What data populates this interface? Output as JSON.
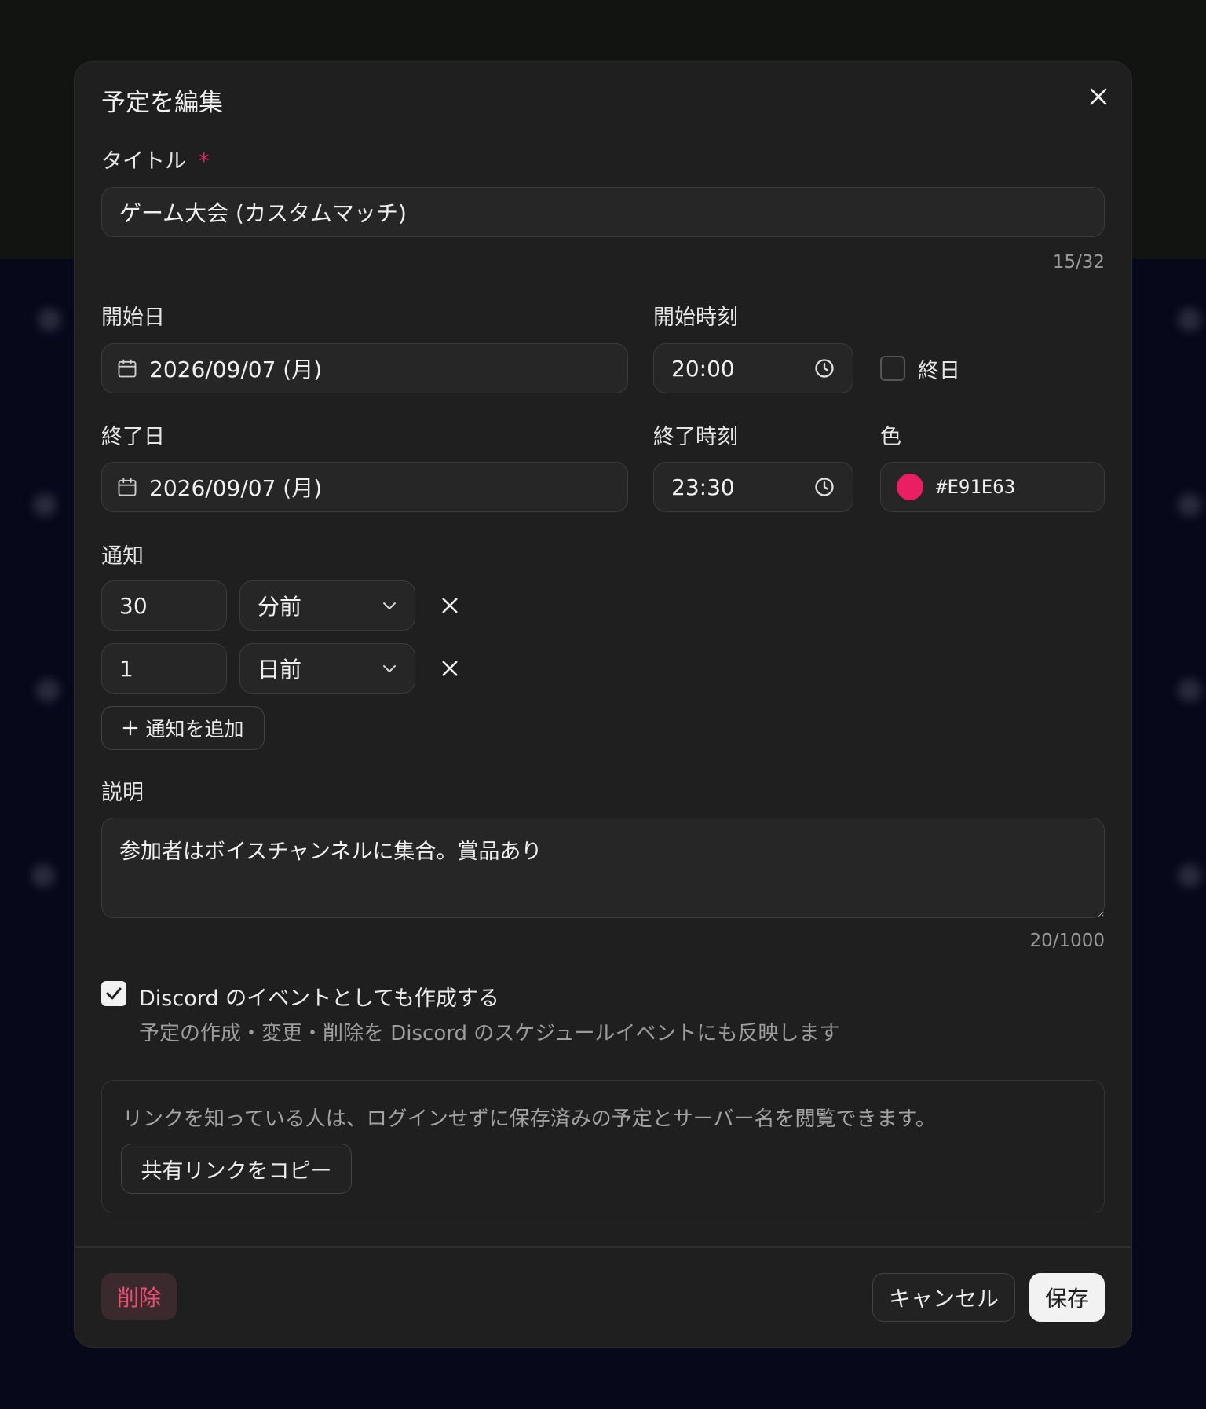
{
  "modal": {
    "title": "予定を編集"
  },
  "title_field": {
    "label": "タイトル",
    "required_mark": "*",
    "value": "ゲーム大会 (カスタムマッチ)",
    "counter": "15/32"
  },
  "start": {
    "date_label": "開始日",
    "date_value": "2026/09/07 (月)",
    "time_label": "開始時刻",
    "time_value": "20:00",
    "all_day_label": "終日"
  },
  "end": {
    "date_label": "終了日",
    "date_value": "2026/09/07 (月)",
    "time_label": "終了時刻",
    "time_value": "23:30"
  },
  "color": {
    "label": "色",
    "value": "#E91E63",
    "swatch": "#E91E63"
  },
  "notifications": {
    "label": "通知",
    "items": [
      {
        "amount": "30",
        "unit": "分前"
      },
      {
        "amount": "1",
        "unit": "日前"
      }
    ],
    "add_label": "通知を追加"
  },
  "description": {
    "label": "説明",
    "value": "参加者はボイスチャンネルに集合。賞品あり",
    "counter": "20/1000"
  },
  "discord": {
    "checked": true,
    "label": "Discord のイベントとしても作成する",
    "helper": "予定の作成・変更・削除を Discord のスケジュールイベントにも反映します"
  },
  "share": {
    "note": "リンクを知っている人は、ログインせずに保存済みの予定とサーバー名を閲覧できます。",
    "copy_label": "共有リンクをコピー"
  },
  "footer": {
    "delete_label": "削除",
    "cancel_label": "キャンセル",
    "save_label": "保存"
  },
  "colors": {
    "accent": "#E91E63",
    "modal_bg": "#1F1F1F"
  }
}
